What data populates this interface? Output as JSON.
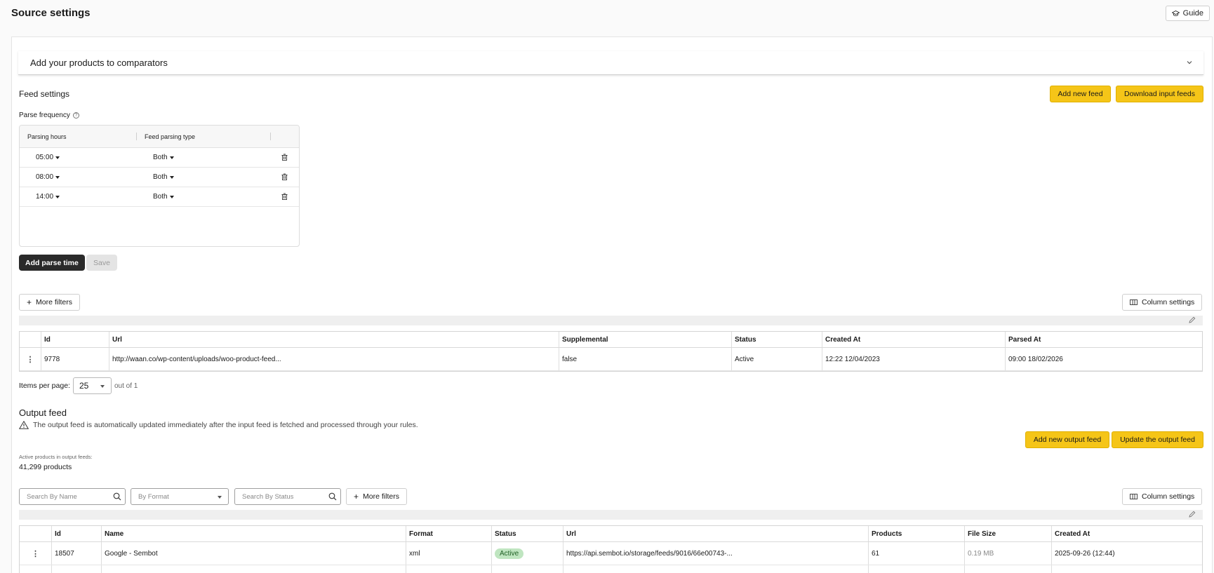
{
  "page": {
    "title": "Source settings",
    "guide_label": "Guide"
  },
  "accordion": {
    "title": "Add your products to comparators"
  },
  "feed_settings": {
    "title": "Feed settings",
    "add_feed_label": "Add new feed",
    "download_label": "Download input feeds",
    "parse_frequency_label": "Parse frequency",
    "parse_table": {
      "headers": [
        "Parsing hours",
        "Feed parsing type"
      ],
      "rows": [
        {
          "hour": "05:00",
          "type": "Both"
        },
        {
          "hour": "08:00",
          "type": "Both"
        },
        {
          "hour": "14:00",
          "type": "Both"
        }
      ]
    },
    "add_parse_time_label": "Add parse time",
    "save_label": "Save"
  },
  "input_table": {
    "more_filters_label": "More filters",
    "column_settings_label": "Column settings",
    "headers": [
      "Id",
      "Url",
      "Supplemental",
      "Status",
      "Created At",
      "Parsed At"
    ],
    "rows": [
      {
        "id": "9778",
        "url": "http://waan.co/wp-content/uploads/woo-product-feed...",
        "supplemental": "false",
        "status": "Active",
        "created_at": "12:22 12/04/2023",
        "parsed_at": "09:00 18/02/2026"
      }
    ],
    "items_per_page_label": "Items per page:",
    "items_per_page_value": "25",
    "out_of_label": "out of 1"
  },
  "output_feed": {
    "title": "Output feed",
    "notice": "The output feed is automatically updated immediately after the input feed is fetched and processed through your rules.",
    "add_output_label": "Add new output feed",
    "update_output_label": "Update the output feed",
    "active_products_label": "Active products in output feeds:",
    "products_count": "41,299 products",
    "search_name_placeholder": "Search By Name",
    "format_placeholder": "By Format",
    "search_status_placeholder": "Search By Status",
    "more_filters_label": "More filters",
    "column_settings_label": "Column settings",
    "headers": [
      "Id",
      "Name",
      "Format",
      "Status",
      "Url",
      "Products",
      "File Size",
      "Created At"
    ],
    "rows": [
      {
        "id": "18507",
        "name": "Google - Sembot",
        "format": "xml",
        "status": "Active",
        "url": "https://api.sembot.io/storage/feeds/9016/66e00743-...",
        "products": "61",
        "file_size": "0.19 MB",
        "created_at": "2025-09-26 (12:44)"
      }
    ]
  },
  "colors": {
    "accent_yellow": "#f5c518",
    "dark_button": "#2a2a2a",
    "active_badge": "#bfe5c0"
  }
}
